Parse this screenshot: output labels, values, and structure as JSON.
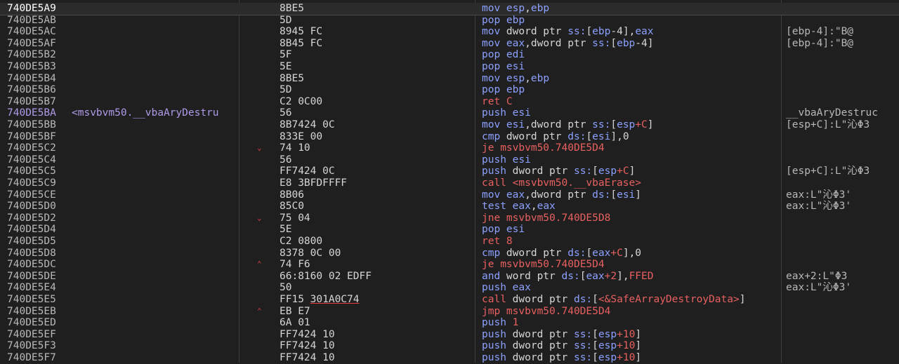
{
  "colors": {
    "background": "#1f1f1f",
    "address": "#b8b8b8",
    "mnemonic": "#8ca0ff",
    "branch": "#e86060",
    "label": "#b09ae8",
    "arrow": "#e83a3a"
  },
  "rows": [
    {
      "addr": "740DE5A9",
      "label": "",
      "arrow": "",
      "bytes": "8BE5",
      "dis": [
        [
          "mov ",
          "mne"
        ],
        [
          "esp",
          "reg"
        ],
        [
          ",",
          "txt"
        ],
        [
          "ebp",
          "reg"
        ]
      ],
      "cmt": "",
      "sel": true
    },
    {
      "addr": "740DE5AB",
      "label": "",
      "arrow": "",
      "bytes": "5D",
      "dis": [
        [
          "pop ",
          "mne"
        ],
        [
          "ebp",
          "reg"
        ]
      ],
      "cmt": ""
    },
    {
      "addr": "740DE5AC",
      "label": "",
      "arrow": "",
      "bytes": "8945 FC",
      "dis": [
        [
          "mov ",
          "mne"
        ],
        [
          "dword ptr ",
          "txt"
        ],
        [
          "ss:",
          "seg"
        ],
        [
          "[",
          "txt"
        ],
        [
          "ebp",
          "reg"
        ],
        [
          "-4",
          "txt"
        ],
        [
          "],",
          "txt"
        ],
        [
          "eax",
          "reg"
        ]
      ],
      "cmt": "[ebp-4]:\"B@"
    },
    {
      "addr": "740DE5AF",
      "label": "",
      "arrow": "",
      "bytes": "8B45 FC",
      "dis": [
        [
          "mov ",
          "mne"
        ],
        [
          "eax",
          "reg"
        ],
        [
          ",dword ptr ",
          "txt"
        ],
        [
          "ss:",
          "seg"
        ],
        [
          "[",
          "txt"
        ],
        [
          "ebp",
          "reg"
        ],
        [
          "-4]",
          "txt"
        ]
      ],
      "cmt": "[ebp-4]:\"B@"
    },
    {
      "addr": "740DE5B2",
      "label": "",
      "arrow": "",
      "bytes": "5F",
      "dis": [
        [
          "pop ",
          "mne"
        ],
        [
          "edi",
          "reg"
        ]
      ],
      "cmt": ""
    },
    {
      "addr": "740DE5B3",
      "label": "",
      "arrow": "",
      "bytes": "5E",
      "dis": [
        [
          "pop ",
          "mne"
        ],
        [
          "esi",
          "reg"
        ]
      ],
      "cmt": ""
    },
    {
      "addr": "740DE5B4",
      "label": "",
      "arrow": "",
      "bytes": "8BE5",
      "dis": [
        [
          "mov ",
          "mne"
        ],
        [
          "esp",
          "reg"
        ],
        [
          ",",
          "txt"
        ],
        [
          "ebp",
          "reg"
        ]
      ],
      "cmt": ""
    },
    {
      "addr": "740DE5B6",
      "label": "",
      "arrow": "",
      "bytes": "5D",
      "dis": [
        [
          "pop ",
          "mne"
        ],
        [
          "ebp",
          "reg"
        ]
      ],
      "cmt": ""
    },
    {
      "addr": "740DE5B7",
      "label": "",
      "arrow": "",
      "bytes": "C2 0C00",
      "dis": [
        [
          "ret ",
          "red"
        ],
        [
          "C",
          "red"
        ]
      ],
      "cmt": ""
    },
    {
      "addr": "740DE5BA",
      "label": "<msvbvm50.__vbaAryDestru",
      "arrow": "",
      "bytes": "56",
      "dis": [
        [
          "push ",
          "mne"
        ],
        [
          "esi",
          "reg"
        ]
      ],
      "cmt": "__vbaAryDestruc",
      "addrClass": "purple"
    },
    {
      "addr": "740DE5BB",
      "label": "",
      "arrow": "",
      "bytes": "8B7424 0C",
      "dis": [
        [
          "mov ",
          "mne"
        ],
        [
          "esi",
          "reg"
        ],
        [
          ",dword ptr ",
          "txt"
        ],
        [
          "ss:",
          "seg"
        ],
        [
          "[",
          "txt"
        ],
        [
          "esp",
          "reg"
        ],
        [
          "+C",
          "num"
        ],
        [
          "]",
          "txt"
        ]
      ],
      "cmt": "[esp+C]:L\"沁Φ3"
    },
    {
      "addr": "740DE5BF",
      "label": "",
      "arrow": "",
      "bytes": "833E 00",
      "dis": [
        [
          "cmp ",
          "mne"
        ],
        [
          "dword ptr ",
          "txt"
        ],
        [
          "ds:",
          "seg"
        ],
        [
          "[",
          "txt"
        ],
        [
          "esi",
          "reg"
        ],
        [
          "],0",
          "txt"
        ]
      ],
      "cmt": ""
    },
    {
      "addr": "740DE5C2",
      "label": "",
      "arrow": "v",
      "bytes": "74 10",
      "dis": [
        [
          "je ",
          "red"
        ],
        [
          "msvbvm50.740DE5D4",
          "red"
        ]
      ],
      "cmt": ""
    },
    {
      "addr": "740DE5C4",
      "label": "",
      "arrow": "",
      "bytes": "56",
      "dis": [
        [
          "push ",
          "mne"
        ],
        [
          "esi",
          "reg"
        ]
      ],
      "cmt": ""
    },
    {
      "addr": "740DE5C5",
      "label": "",
      "arrow": "",
      "bytes": "FF7424 0C",
      "dis": [
        [
          "push ",
          "mne"
        ],
        [
          "dword ptr ",
          "txt"
        ],
        [
          "ss:",
          "seg"
        ],
        [
          "[",
          "txt"
        ],
        [
          "esp",
          "reg"
        ],
        [
          "+C",
          "num"
        ],
        [
          "]",
          "txt"
        ]
      ],
      "cmt": "[esp+C]:L\"沁Φ3"
    },
    {
      "addr": "740DE5C9",
      "label": "",
      "arrow": "",
      "bytes": "E8 3BFDFFFF",
      "dis": [
        [
          "call ",
          "red"
        ],
        [
          "<msvbvm50.__vbaErase>",
          "red"
        ]
      ],
      "cmt": ""
    },
    {
      "addr": "740DE5CE",
      "label": "",
      "arrow": "",
      "bytes": "8B06",
      "dis": [
        [
          "mov ",
          "mne"
        ],
        [
          "eax",
          "reg"
        ],
        [
          ",dword ptr ",
          "txt"
        ],
        [
          "ds:",
          "seg"
        ],
        [
          "[",
          "txt"
        ],
        [
          "esi",
          "reg"
        ],
        [
          "]",
          "txt"
        ]
      ],
      "cmt": "eax:L\"沁Φ3'"
    },
    {
      "addr": "740DE5D0",
      "label": "",
      "arrow": "",
      "bytes": "85C0",
      "dis": [
        [
          "test ",
          "mne"
        ],
        [
          "eax",
          "reg"
        ],
        [
          ",",
          "txt"
        ],
        [
          "eax",
          "reg"
        ]
      ],
      "cmt": "eax:L\"沁Φ3'"
    },
    {
      "addr": "740DE5D2",
      "label": "",
      "arrow": "v",
      "bytes": "75 04",
      "dis": [
        [
          "jne ",
          "red"
        ],
        [
          "msvbvm50.740DE5D8",
          "red"
        ]
      ],
      "cmt": ""
    },
    {
      "addr": "740DE5D4",
      "label": "",
      "arrow": "",
      "bytes": "5E",
      "dis": [
        [
          "pop ",
          "mne"
        ],
        [
          "esi",
          "reg"
        ]
      ],
      "cmt": ""
    },
    {
      "addr": "740DE5D5",
      "label": "",
      "arrow": "",
      "bytes": "C2 0800",
      "dis": [
        [
          "ret ",
          "red"
        ],
        [
          "8",
          "red"
        ]
      ],
      "cmt": ""
    },
    {
      "addr": "740DE5D8",
      "label": "",
      "arrow": "",
      "bytes": "8378 0C 00",
      "dis": [
        [
          "cmp ",
          "mne"
        ],
        [
          "dword ptr ",
          "txt"
        ],
        [
          "ds:",
          "seg"
        ],
        [
          "[",
          "txt"
        ],
        [
          "eax",
          "reg"
        ],
        [
          "+C",
          "num"
        ],
        [
          "],0",
          "txt"
        ]
      ],
      "cmt": ""
    },
    {
      "addr": "740DE5DC",
      "label": "",
      "arrow": "^",
      "bytes": "74 F6",
      "dis": [
        [
          "je ",
          "red"
        ],
        [
          "msvbvm50.740DE5D4",
          "red"
        ]
      ],
      "cmt": ""
    },
    {
      "addr": "740DE5DE",
      "label": "",
      "arrow": "",
      "bytes": "66:8160 02 EDFF",
      "dis": [
        [
          "and ",
          "mne"
        ],
        [
          "word ptr ",
          "txt"
        ],
        [
          "ds:",
          "seg"
        ],
        [
          "[",
          "txt"
        ],
        [
          "eax",
          "reg"
        ],
        [
          "+2",
          "num"
        ],
        [
          "],",
          "txt"
        ],
        [
          "FFED",
          "num"
        ]
      ],
      "cmt": "eax+2:L\"Φ3"
    },
    {
      "addr": "740DE5E4",
      "label": "",
      "arrow": "",
      "bytes": "50",
      "dis": [
        [
          "push ",
          "mne"
        ],
        [
          "eax",
          "reg"
        ]
      ],
      "cmt": "eax:L\"沁Φ3'"
    },
    {
      "addr": "740DE5E5",
      "label": "",
      "arrow": "",
      "bytes": "FF15 301A0C74",
      "bytesUl": "301A0C74",
      "dis": [
        [
          "call ",
          "red"
        ],
        [
          "dword ptr ",
          "txt"
        ],
        [
          "ds:",
          "seg"
        ],
        [
          "[",
          "txt"
        ],
        [
          "<&SafeArrayDestroyData>",
          "red"
        ],
        [
          "]",
          "txt"
        ]
      ],
      "cmt": ""
    },
    {
      "addr": "740DE5EB",
      "label": "",
      "arrow": "^",
      "bytes": "EB E7",
      "dis": [
        [
          "jmp ",
          "red"
        ],
        [
          "msvbvm50.740DE5D4",
          "red"
        ]
      ],
      "cmt": ""
    },
    {
      "addr": "740DE5ED",
      "label": "",
      "arrow": "",
      "bytes": "6A 01",
      "dis": [
        [
          "push ",
          "mne"
        ],
        [
          "1",
          "num"
        ]
      ],
      "cmt": ""
    },
    {
      "addr": "740DE5EF",
      "label": "",
      "arrow": "",
      "bytes": "FF7424 10",
      "dis": [
        [
          "push ",
          "mne"
        ],
        [
          "dword ptr ",
          "txt"
        ],
        [
          "ss:",
          "seg"
        ],
        [
          "[",
          "txt"
        ],
        [
          "esp",
          "reg"
        ],
        [
          "+10",
          "num"
        ],
        [
          "]",
          "txt"
        ]
      ],
      "cmt": ""
    },
    {
      "addr": "740DE5F3",
      "label": "",
      "arrow": "",
      "bytes": "FF7424 10",
      "dis": [
        [
          "push ",
          "mne"
        ],
        [
          "dword ptr ",
          "txt"
        ],
        [
          "ss:",
          "seg"
        ],
        [
          "[",
          "txt"
        ],
        [
          "esp",
          "reg"
        ],
        [
          "+10",
          "num"
        ],
        [
          "]",
          "txt"
        ]
      ],
      "cmt": ""
    },
    {
      "addr": "740DE5F7",
      "label": "",
      "arrow": "",
      "bytes": "FF7424 10",
      "dis": [
        [
          "push ",
          "mne"
        ],
        [
          "dword ptr ",
          "txt"
        ],
        [
          "ss:",
          "seg"
        ],
        [
          "[",
          "txt"
        ],
        [
          "esp",
          "reg"
        ],
        [
          "+10",
          "num"
        ],
        [
          "]",
          "txt"
        ]
      ],
      "cmt": ""
    }
  ]
}
